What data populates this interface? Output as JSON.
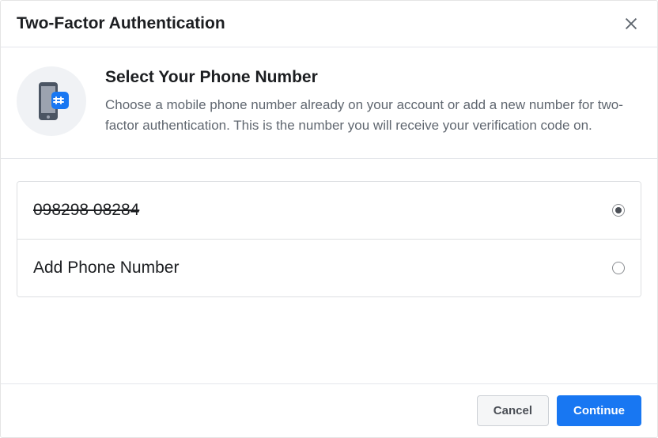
{
  "header": {
    "title": "Two-Factor Authentication"
  },
  "intro": {
    "heading": "Select Your Phone Number",
    "description": "Choose a mobile phone number already on your account or add a new number for two-factor authentication. This is the number you will receive your verification code on."
  },
  "options": {
    "existing_number": "098298 08284",
    "add_number_label": "Add Phone Number"
  },
  "footer": {
    "cancel_label": "Cancel",
    "continue_label": "Continue"
  }
}
